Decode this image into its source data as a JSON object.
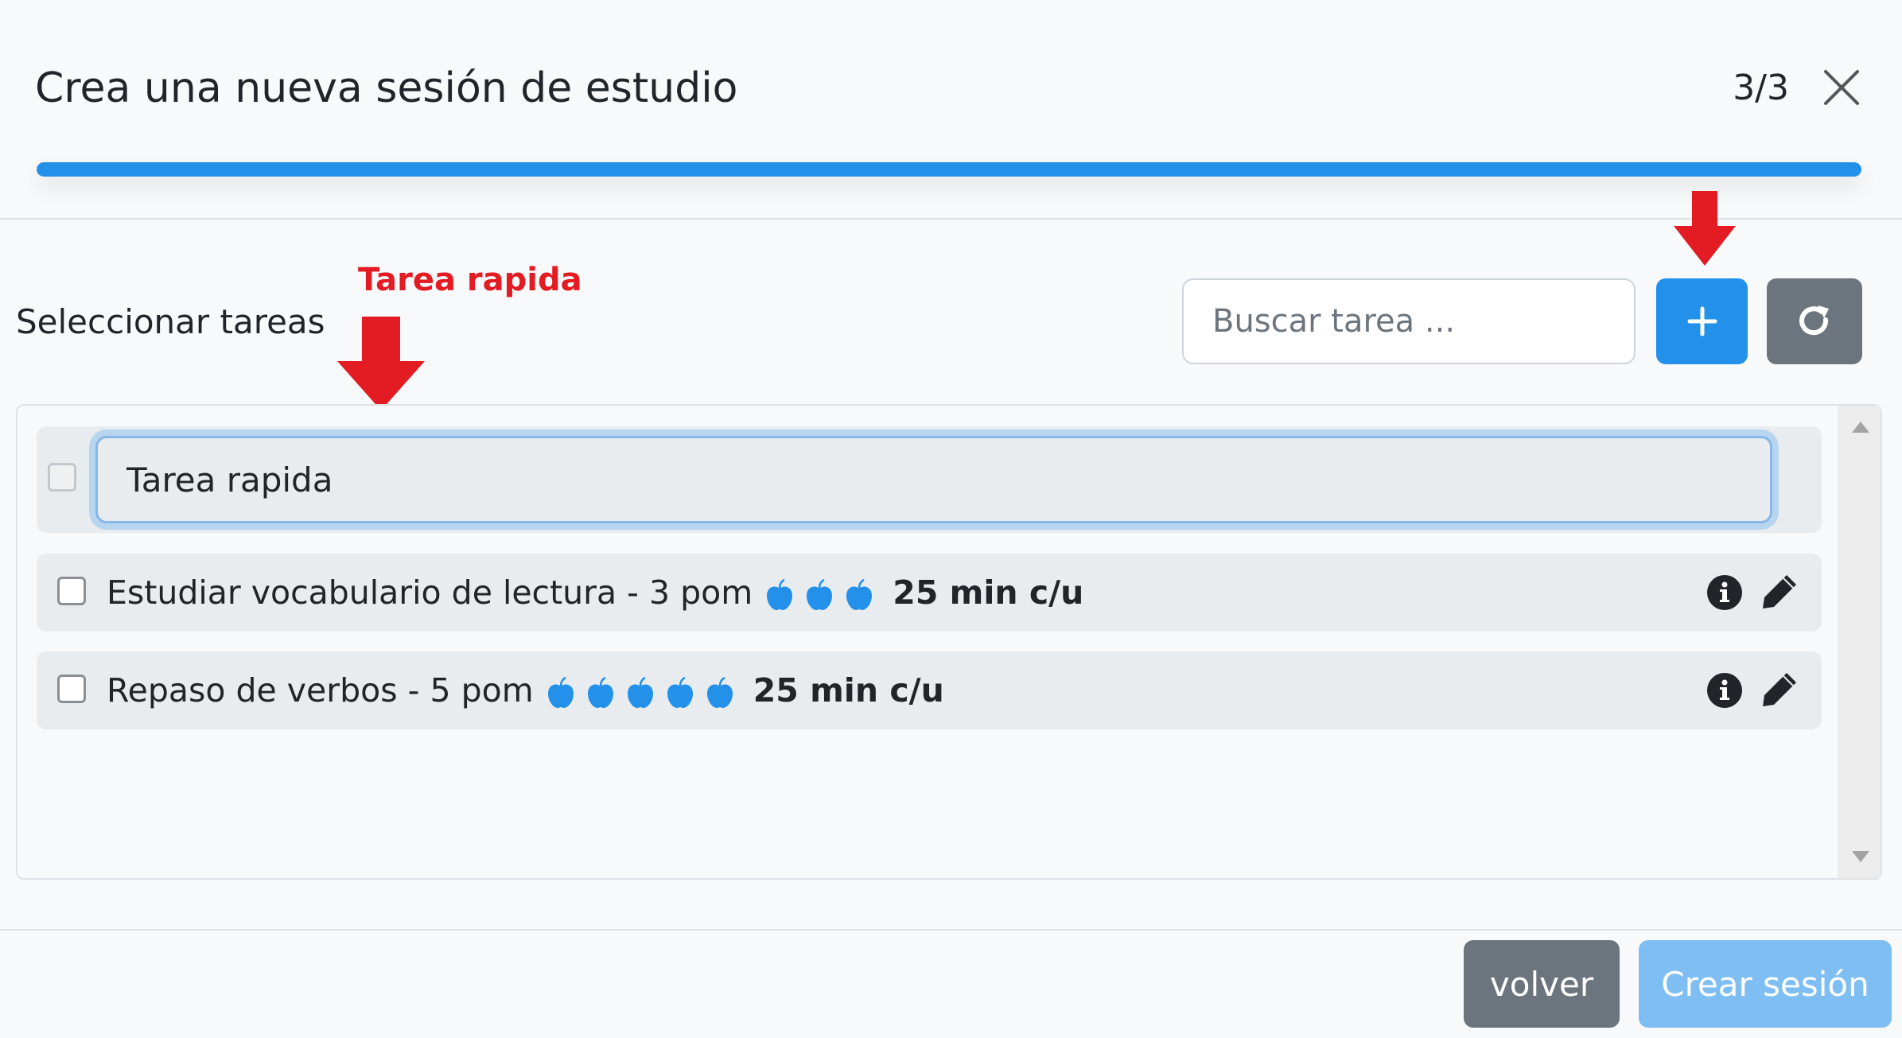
{
  "modal": {
    "title": "Crea una nueva sesión de estudio",
    "step": "3/3",
    "progress_percent": 100,
    "accent_color": "#2391ea"
  },
  "toolbar": {
    "select_label": "Seleccionar tareas",
    "search_placeholder": "Buscar tarea ...",
    "add_icon": "plus-icon",
    "refresh_icon": "refresh-icon"
  },
  "annotation": {
    "label": "Tarea rapida",
    "color": "#e31b23"
  },
  "quick_task": {
    "value": "Tarea rapida"
  },
  "tasks": [
    {
      "name": "Estudiar vocabulario de lectura - ",
      "pom_label": "3 pom",
      "pomodoros": 3,
      "duration": "25 min c/u",
      "icon": "apple-icon"
    },
    {
      "name": "Repaso de verbos - ",
      "pom_label": "5 pom",
      "pomodoros": 5,
      "duration": "25 min c/u",
      "icon": "apple-icon"
    }
  ],
  "footer": {
    "back_label": "volver",
    "create_label": "Crear sesión"
  }
}
